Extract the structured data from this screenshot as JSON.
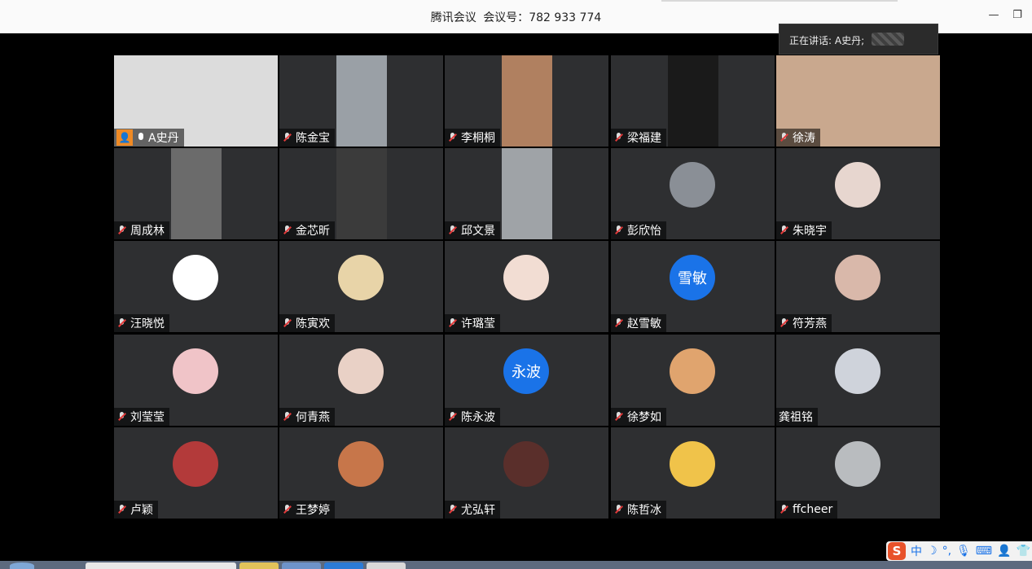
{
  "window": {
    "app_name": "腾讯会议",
    "meeting_label": "会议号：",
    "meeting_id": "782 933 774",
    "minimize_glyph": "—",
    "restore_glyph": "❐"
  },
  "speaking": {
    "label": "正在讲话: A史丹;"
  },
  "participants": [
    {
      "name": "A史丹",
      "host": true,
      "mic": "on",
      "media": "video",
      "bg": "#dcdcdc"
    },
    {
      "name": "陈金宝",
      "mic": "off",
      "media": "video",
      "bg": "#9aa0a6"
    },
    {
      "name": "李桐桐",
      "mic": "off",
      "media": "video",
      "bg": "#b08060"
    },
    {
      "name": "梁福建",
      "mic": "off",
      "media": "video",
      "bg": "#1a1a1a"
    },
    {
      "name": "徐涛",
      "mic": "off",
      "media": "video",
      "bg": "#c9a88e"
    },
    {
      "name": "周成林",
      "mic": "off",
      "media": "video",
      "bg": "#6b6b6b"
    },
    {
      "name": "金芯昕",
      "mic": "off",
      "media": "video",
      "bg": "#3b3b3b"
    },
    {
      "name": "邱文景",
      "mic": "off",
      "media": "video",
      "bg": "#9fa3a7"
    },
    {
      "name": "彭欣怡",
      "mic": "off",
      "media": "avatar",
      "bg": "#8a8f96"
    },
    {
      "name": "朱晓宇",
      "mic": "off",
      "media": "avatar",
      "bg": "#e7d6cf"
    },
    {
      "name": "汪晓悦",
      "mic": "off",
      "media": "avatar",
      "bg": "#ffffff"
    },
    {
      "name": "陈寅欢",
      "mic": "off",
      "media": "avatar",
      "bg": "#e8d4a8"
    },
    {
      "name": "许璐莹",
      "mic": "off",
      "media": "avatar",
      "bg": "#f2ddd3"
    },
    {
      "name": "赵雪敏",
      "mic": "off",
      "media": "text_avatar",
      "avatar_text": "雪敏",
      "bg": "#1a73e8"
    },
    {
      "name": "符芳燕",
      "mic": "off",
      "media": "avatar",
      "bg": "#d9b8aa"
    },
    {
      "name": "刘莹莹",
      "mic": "off",
      "media": "avatar",
      "bg": "#f0c4c8"
    },
    {
      "name": "何青燕",
      "mic": "off",
      "media": "avatar",
      "bg": "#e9d1c6"
    },
    {
      "name": "陈永波",
      "mic": "off",
      "media": "text_avatar",
      "avatar_text": "永波",
      "bg": "#1a73e8"
    },
    {
      "name": "徐梦如",
      "mic": "off",
      "media": "avatar",
      "bg": "#e0a46e"
    },
    {
      "name": "龚祖铭",
      "mic": "none",
      "media": "avatar",
      "bg": "#cfd3db"
    },
    {
      "name": "卢颖",
      "mic": "off",
      "media": "avatar",
      "bg": "#b33a3a"
    },
    {
      "name": "王梦婷",
      "mic": "off",
      "media": "avatar",
      "bg": "#c7764a"
    },
    {
      "name": "尤弘轩",
      "mic": "off",
      "media": "avatar",
      "bg": "#5a2f2b"
    },
    {
      "name": "陈哲冰",
      "mic": "off",
      "media": "avatar",
      "bg": "#f0c34a"
    },
    {
      "name": "ffcheer",
      "mic": "off",
      "media": "avatar",
      "bg": "#b9bcbf"
    }
  ],
  "ime": {
    "logo": "S",
    "mode": "中",
    "icons": [
      "moon-icon",
      "punctuation-icon",
      "mic-icon",
      "keyboard-icon",
      "user-icon",
      "shirt-icon"
    ],
    "glyphs": [
      "☽",
      "°,",
      "🎙",
      "⌨",
      "👤",
      "👕"
    ]
  }
}
